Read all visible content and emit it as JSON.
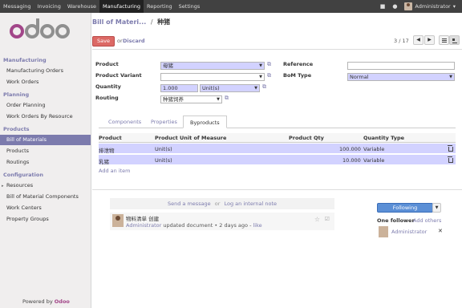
{
  "topbar": {
    "menu": [
      "Messaging",
      "Invoicing",
      "Warehouse",
      "Manufacturing",
      "Reporting",
      "Settings"
    ],
    "active": "Manufacturing",
    "user": "Administrator"
  },
  "sidebar": {
    "sections": [
      {
        "title": "Manufacturing",
        "items": [
          "Manufacturing Orders",
          "Work Orders"
        ]
      },
      {
        "title": "Planning",
        "items": [
          "Order Planning",
          "Work Orders By Resource"
        ]
      },
      {
        "title": "Products",
        "items": [
          "Bill of Materials",
          "Products",
          "Routings"
        ]
      },
      {
        "title": "Configuration",
        "items": [
          "Resources",
          "Bill of Material Components",
          "Work Centers",
          "Property Groups"
        ]
      }
    ],
    "active_item": "Bill of Materials",
    "powered_prefix": "Powered by",
    "powered_brand": "Odoo"
  },
  "header": {
    "breadcrumb_parent": "Bill of Materi...",
    "breadcrumb_sep": "/",
    "breadcrumb_current": "种猪",
    "save_label": "Save",
    "or_label": "or",
    "discard_label": "Discard",
    "pager": "3 / 17"
  },
  "form": {
    "product_label": "Product",
    "product_value": "母猪",
    "variant_label": "Product Variant",
    "variant_value": "",
    "quantity_label": "Quantity",
    "quantity_value": "1.000",
    "uom_value": "Unit(s)",
    "routing_label": "Routing",
    "routing_value": "种猪饲养",
    "reference_label": "Reference",
    "reference_value": "",
    "bomtype_label": "BoM Type",
    "bomtype_value": "Normal"
  },
  "tabs": [
    "Components",
    "Properties",
    "Byproducts"
  ],
  "active_tab": "Byproducts",
  "table": {
    "headers": [
      "Product",
      "Product Unit of Measure",
      "Product Qty",
      "Quantity Type"
    ],
    "rows": [
      {
        "product": "排泄物",
        "uom": "Unit(s)",
        "qty": "100.000",
        "type": "Variable"
      },
      {
        "product": "乳猪",
        "uom": "Unit(s)",
        "qty": "10.000",
        "type": "Variable"
      }
    ],
    "add_item": "Add an item"
  },
  "chatter": {
    "send_message": "Send a message",
    "or": "or",
    "log_note": "Log an internal note",
    "msg_title": "物料清单 创建",
    "msg_author": "Administrator",
    "msg_text": "updated document",
    "msg_time": "2 days ago",
    "msg_like": "like",
    "follow_label": "Following",
    "followers_label": "One follower",
    "add_others": "Add others",
    "follower_name": "Administrator"
  }
}
